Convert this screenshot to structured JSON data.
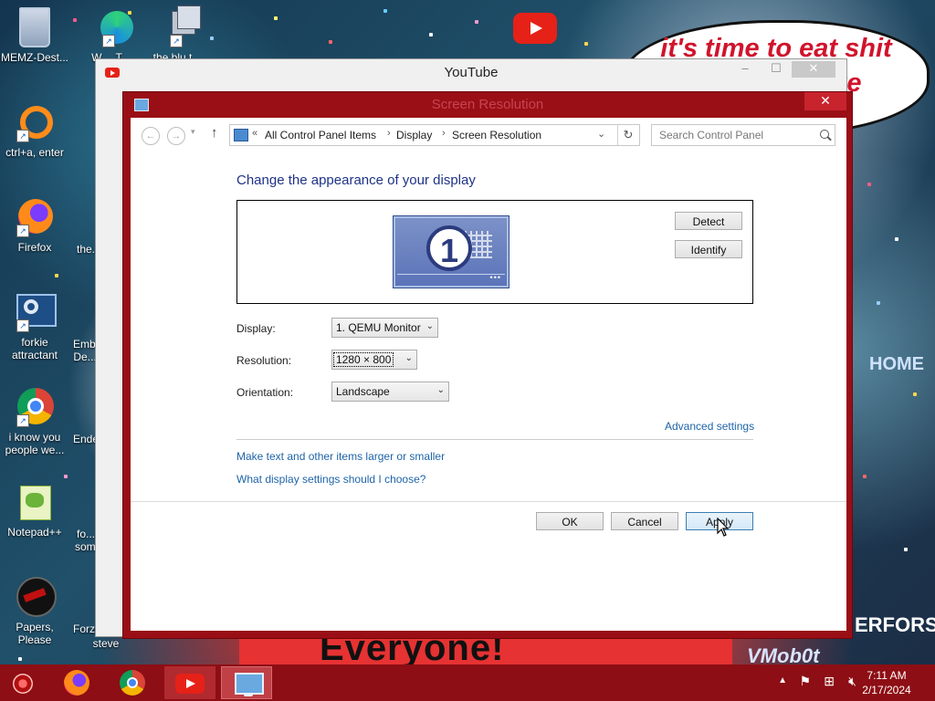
{
  "desktop": {
    "bubble_text": "it's time to eat shit and celebrate",
    "banner_text": "Everyone!",
    "corner_text": "VMob0t",
    "wall_words": [
      "HOME",
      "ERFORS"
    ],
    "icons": [
      {
        "label": "MEMZ-Dest..."
      },
      {
        "label": "W… T…"
      },
      {
        "label": "the blu t..."
      },
      {
        "label": "ctrl+a, enter"
      },
      {
        "label": "Firefox"
      },
      {
        "label": "the..."
      },
      {
        "label": "forkie attractant"
      },
      {
        "label": "Emb... De..."
      },
      {
        "label": "i know you people we..."
      },
      {
        "label": "Ende..."
      },
      {
        "label": "Notepad++"
      },
      {
        "label": "fo... som..."
      },
      {
        "label": "Papers, Please"
      },
      {
        "label": "Forz..."
      },
      {
        "label": "steve"
      }
    ]
  },
  "youtube_window": {
    "title": "YouTube",
    "minimize": "–",
    "maximize": "☐",
    "close": "✕"
  },
  "sr_window": {
    "title": "Screen Resolution",
    "close": "✕",
    "nav": {
      "back": "←",
      "forward": "→",
      "up": "↑",
      "breadcrumbs": [
        "All Control Panel Items",
        "Display",
        "Screen Resolution"
      ],
      "search_placeholder": "Search Control Panel"
    },
    "heading": "Change the appearance of your display",
    "monitor_number": "1",
    "detect_label": "Detect",
    "identify_label": "Identify",
    "display_label": "Display:",
    "display_value": "1. QEMU Monitor",
    "resolution_label": "Resolution:",
    "resolution_value": "1280 × 800",
    "orientation_label": "Orientation:",
    "orientation_value": "Landscape",
    "advanced_link": "Advanced settings",
    "link_text_size": "Make text and other items larger or smaller",
    "link_display_help": "What display settings should I choose?",
    "ok_label": "OK",
    "cancel_label": "Cancel",
    "apply_label": "Apply"
  },
  "taskbar": {
    "time": "7:11 AM",
    "date": "2/17/2024",
    "apps": [
      "firefox-icon",
      "chrome-icon",
      "youtube-icon",
      "display-settings-icon"
    ]
  },
  "colors": {
    "accent": "#9a0f16",
    "taskbar": "#8d0e14",
    "link": "#1e64a8",
    "heading": "#1e3287"
  }
}
